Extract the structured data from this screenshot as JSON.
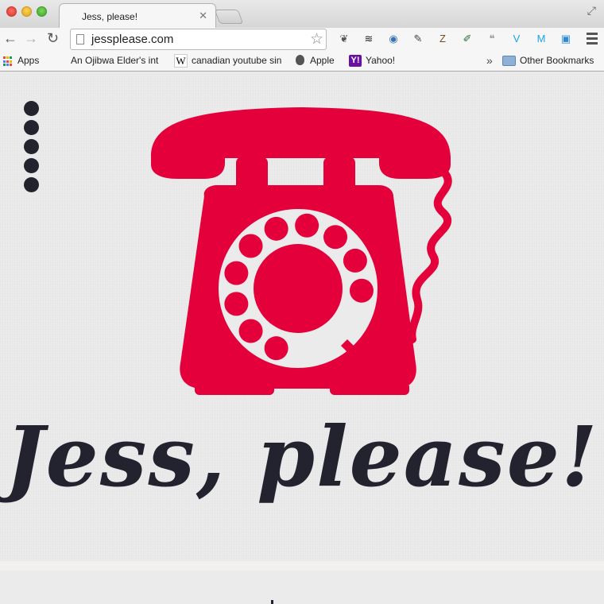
{
  "window": {
    "tab_title": "Jess, please!",
    "tab_close": "✕",
    "fullscreen_icon": "⤢"
  },
  "toolbar": {
    "back_icon": "←",
    "forward_icon": "→",
    "reload_icon": "↻",
    "url": "jessplease.com",
    "star_icon": "☆",
    "extensions": [
      {
        "name": "leaf-extension-icon",
        "glyph": "❦",
        "color": "#555555"
      },
      {
        "name": "buffer-extension-icon",
        "glyph": "≋",
        "color": "#222222"
      },
      {
        "name": "owl-extension-icon",
        "glyph": "◉",
        "color": "#3b6fb6"
      },
      {
        "name": "wrench-extension-icon",
        "glyph": "✎",
        "color": "#444444"
      },
      {
        "name": "z-extension-icon",
        "glyph": "Z",
        "color": "#7a4a1e"
      },
      {
        "name": "eyedropper-extension-icon",
        "glyph": "✐",
        "color": "#2a6a3a"
      },
      {
        "name": "quote-extension-icon",
        "glyph": "❝",
        "color": "#999999"
      },
      {
        "name": "v-extension-icon",
        "glyph": "V",
        "color": "#1aa3e8"
      },
      {
        "name": "m-extension-icon",
        "glyph": "M",
        "color": "#1aa3e8"
      },
      {
        "name": "box-extension-icon",
        "glyph": "▣",
        "color": "#2a8ad6"
      }
    ]
  },
  "bookmarks": {
    "apps_label": "Apps",
    "items": [
      {
        "label": "An Ojibwa Elder's int"
      },
      {
        "label": "canadian youtube sin"
      },
      {
        "label": "Apple"
      },
      {
        "label": "Yahoo!"
      }
    ],
    "overflow": "»",
    "other_label": "Other Bookmarks",
    "wiki_glyph": "W",
    "yahoo_glyph": "Y!"
  },
  "page": {
    "headline": "Jess, please!",
    "accent_color": "#e4003a",
    "ink_color": "#23232f",
    "menu_dots": 5
  }
}
